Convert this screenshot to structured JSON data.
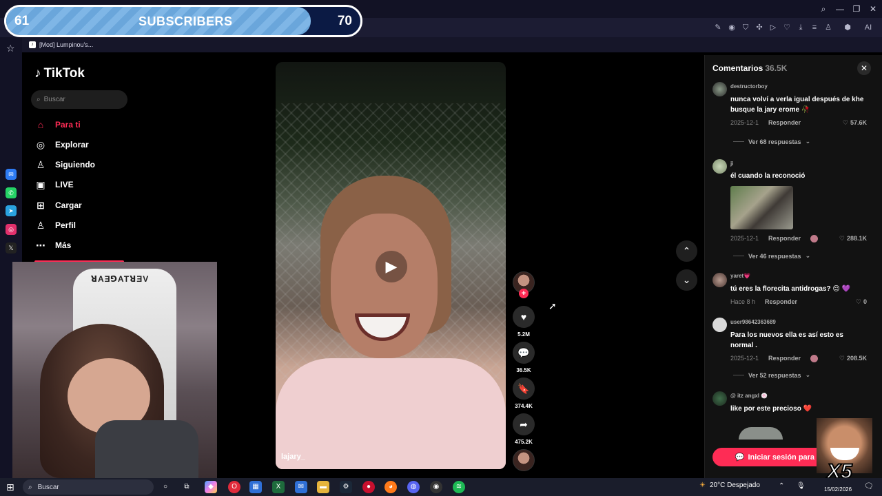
{
  "goal": {
    "min": "61",
    "label": "SUBSCRIBERS",
    "max": "70",
    "progress_percent": 86
  },
  "browser": {
    "bookmark_label": "[Mod] Lumpinou's...",
    "toolbar_ai_label": "AI"
  },
  "tiktok": {
    "logo": "TikTok",
    "search_placeholder": "Buscar",
    "nav": [
      {
        "label": "Para ti",
        "icon": "home-icon"
      },
      {
        "label": "Explorar",
        "icon": "compass-icon"
      },
      {
        "label": "Siguiendo",
        "icon": "following-icon"
      },
      {
        "label": "LIVE",
        "icon": "live-icon"
      },
      {
        "label": "Cargar",
        "icon": "upload-icon"
      },
      {
        "label": "Perfil",
        "icon": "profile-icon"
      },
      {
        "label": "Más",
        "icon": "more-icon"
      }
    ]
  },
  "webcam": {
    "chair_text": "ꓤAƎꓨATꓤƎV"
  },
  "video": {
    "author": "lajary_",
    "likes": "5.2M",
    "comments": "36.5K",
    "saves": "374.4K",
    "shares": "475.2K"
  },
  "comments": {
    "title": "Comentarios",
    "count": "36.5K",
    "items": [
      {
        "user": "destructorboy",
        "text": "nunca volví a verla igual después de khe busque la jary erome 🥀",
        "date": "2025-12-1",
        "reply": "Responder",
        "likes": "57.6K",
        "replies": "Ver 68 respuestas"
      },
      {
        "user": "ji",
        "text": "él cuando la reconoció",
        "date": "2025-12-1",
        "reply": "Responder",
        "likes": "288.1K",
        "replies": "Ver 46 respuestas"
      },
      {
        "user": "yaret💗",
        "text": "tú eres la florecita antidrogas? 😌 💜",
        "date": "Hace 8 h",
        "reply": "Responder",
        "likes": "0"
      },
      {
        "user": "user98642363689",
        "text": "Para los nuevos ella es así esto es normal .",
        "date": "2025-12-1",
        "reply": "Responder",
        "likes": "208.5K",
        "replies": "Ver 52 respuestas"
      },
      {
        "user": "@ itz angxl 🍥",
        "text": "like por este precioso ❤️"
      }
    ],
    "login_label": "Iniciar sesión para c"
  },
  "meme": {
    "text": "X5"
  },
  "taskbar": {
    "search_label": "Buscar",
    "weather": "20°C  Despejado",
    "date": "15/02/2026"
  },
  "colors": {
    "brand": "#fe2c55",
    "goal_fill": "#7fb6e6",
    "goal_bg": "#0b1a44"
  }
}
